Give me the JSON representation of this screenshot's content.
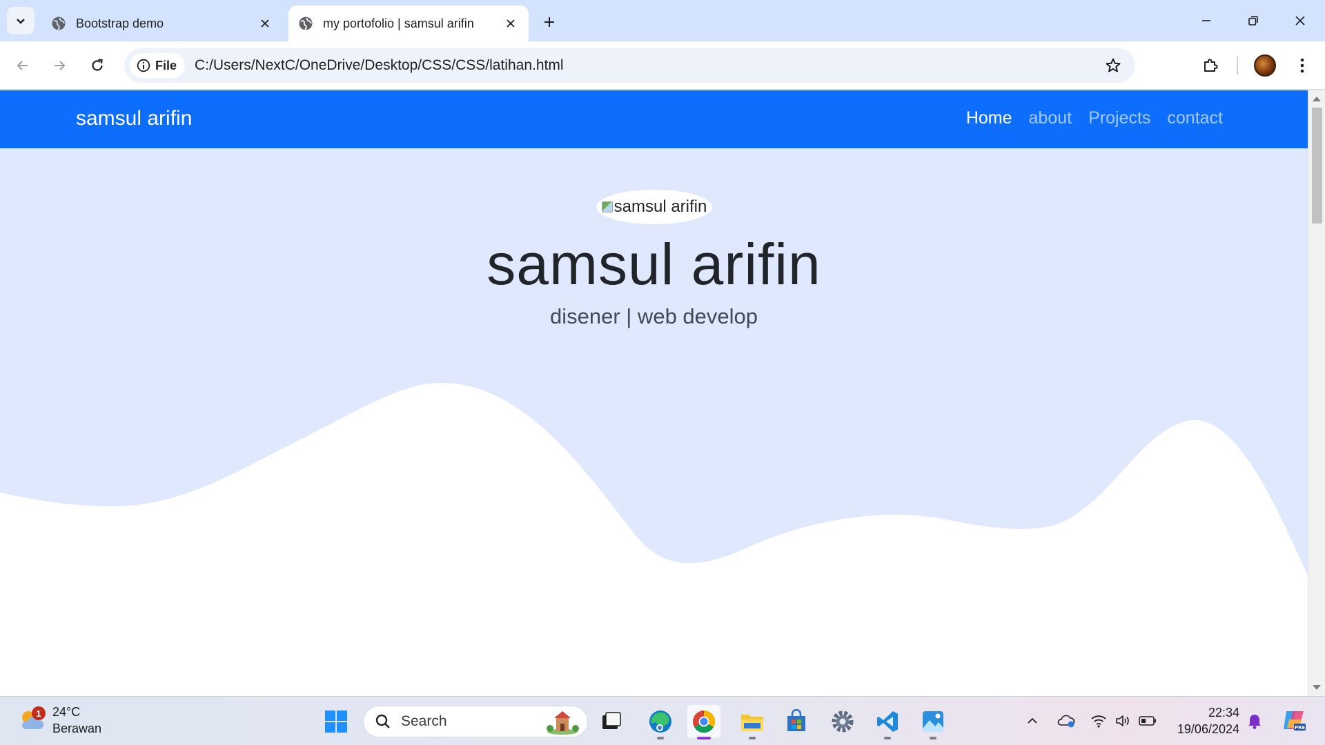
{
  "browser": {
    "tabs": [
      {
        "title": "Bootstrap demo",
        "active": false
      },
      {
        "title": "my portofolio | samsul arifin",
        "active": true
      }
    ],
    "site_chip_label": "File",
    "url": "C:/Users/NextC/OneDrive/Desktop/CSS/CSS/latihan.html"
  },
  "page": {
    "brand": "samsul arifin",
    "nav": [
      "Home",
      "about",
      "Projects",
      "contact"
    ],
    "hero": {
      "image_alt": "samsul arifin",
      "title": "samsul arifin",
      "subtitle": "disener | web develop"
    },
    "colors": {
      "navbar": "#0d6efd",
      "hero_bg": "#dfe8fd",
      "wave": "#ffffff"
    }
  },
  "taskbar": {
    "weather": {
      "temp": "24°C",
      "condition": "Berawan",
      "badge": "1"
    },
    "search_label": "Search",
    "apps": [
      "start-icon",
      "task-view-icon",
      "edge-icon",
      "chrome-icon",
      "file-explorer-icon",
      "store-icon",
      "settings-icon",
      "vscode-icon",
      "photos-icon"
    ],
    "time": "22:34",
    "date": "19/06/2024"
  }
}
